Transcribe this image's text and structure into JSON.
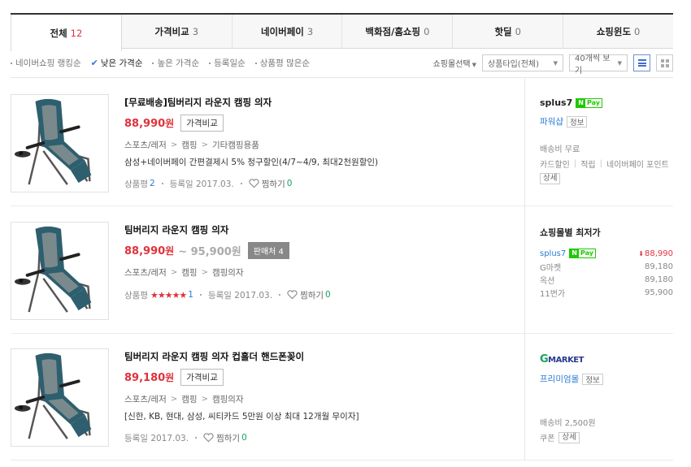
{
  "tabs": [
    {
      "label": "전체",
      "count": "12",
      "active": true
    },
    {
      "label": "가격비교",
      "count": "3"
    },
    {
      "label": "네이버페이",
      "count": "3"
    },
    {
      "label": "백화점/홈쇼핑",
      "count": "0"
    },
    {
      "label": "핫딜",
      "count": "0"
    },
    {
      "label": "쇼핑윈도",
      "count": "0"
    }
  ],
  "sort": {
    "options": [
      "네이버쇼핑 랭킹순",
      "낮은 가격순",
      "높은 가격순",
      "등록일순",
      "상품평 많은순"
    ],
    "active_index": 1
  },
  "controls": {
    "mall_select": "쇼핑몰선택",
    "type_select": "상품타입(전체)",
    "count_select": "40개씩 보기"
  },
  "items": [
    {
      "title": "[무료배송]팀버리지 라운지 캠핑 의자",
      "price": "88,990",
      "won": "원",
      "button": "가격비교",
      "categories": [
        "스포츠/레저",
        "캠핑",
        "기타캠핑용품"
      ],
      "desc": "삼성+네이버페이 간편결제시 5% 청구할인(4/7~4/9, 최대2천원할인)",
      "review_label": "상품평",
      "review_count": "2",
      "reg_label": "등록일 2017.03.",
      "zzim_label": "찜하기",
      "zzim_count": "0",
      "mall": {
        "name": "splus7",
        "grade": "파워샵",
        "info": "정보",
        "line1": "배송비 무료",
        "line2": [
          "카드할인",
          "적립",
          "네이버페이 포인트"
        ],
        "detail": "상세"
      }
    },
    {
      "title": "팀버리지 라운지 캠핑 의자",
      "price": "88,990",
      "won": "원",
      "price_range": "~ 95,900원",
      "button": "판매처 4",
      "categories": [
        "스포츠/레저",
        "캠핑",
        "캠핑의자"
      ],
      "review_label": "상품평",
      "stars": "★★★★★",
      "review_count": "1",
      "reg_label": "등록일 2017.03.",
      "zzim_label": "찜하기",
      "zzim_count": "0",
      "lowest": {
        "title": "쇼핑몰별 최저가",
        "rows": [
          {
            "name": "splus7",
            "price": "88,990"
          },
          {
            "name": "G마켓",
            "price": "89,180"
          },
          {
            "name": "옥션",
            "price": "89,180"
          },
          {
            "name": "11번가",
            "price": "95,900"
          }
        ]
      }
    },
    {
      "title": "팀버리지 라운지 캠핑 의자 컵홀더 핸드폰꽂이",
      "price": "89,180",
      "won": "원",
      "button": "가격비교",
      "categories": [
        "스포츠/레저",
        "캠핑",
        "캠핑의자"
      ],
      "desc": "[신한, KB, 현대, 삼성, 씨티카드 5만원 이상 최대 12개월 무이자]",
      "reg_label": "등록일 2017.03.",
      "zzim_label": "찜하기",
      "zzim_count": "0",
      "mall": {
        "logo_g": "G",
        "logo_rest": "MARKET",
        "grade": "프리미엄몰",
        "info": "정보",
        "line1": "배송비 2,500원",
        "line2": [
          "쿠폰"
        ],
        "detail": "상세"
      }
    }
  ],
  "npay": {
    "n": "N",
    "pay": "Pay"
  },
  "colors": {
    "accent_red": "#e0323c",
    "link_blue": "#2b7bd6",
    "npay_green": "#1ec800"
  }
}
